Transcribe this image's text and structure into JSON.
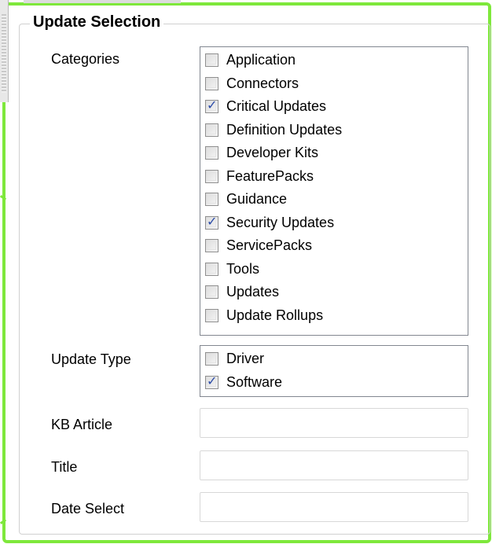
{
  "group": {
    "title": "Update Selection"
  },
  "categories": {
    "label": "Categories",
    "items": [
      {
        "label": "Application",
        "checked": false
      },
      {
        "label": "Connectors",
        "checked": false
      },
      {
        "label": "Critical Updates",
        "checked": true
      },
      {
        "label": "Definition Updates",
        "checked": false
      },
      {
        "label": "Developer Kits",
        "checked": false
      },
      {
        "label": "FeaturePacks",
        "checked": false
      },
      {
        "label": "Guidance",
        "checked": false
      },
      {
        "label": "Security Updates",
        "checked": true
      },
      {
        "label": "ServicePacks",
        "checked": false
      },
      {
        "label": "Tools",
        "checked": false
      },
      {
        "label": "Updates",
        "checked": false
      },
      {
        "label": "Update Rollups",
        "checked": false
      }
    ]
  },
  "update_type": {
    "label": "Update Type",
    "items": [
      {
        "label": "Driver",
        "checked": false
      },
      {
        "label": "Software",
        "checked": true
      }
    ]
  },
  "kb_article": {
    "label": "KB Article",
    "value": ""
  },
  "title_field": {
    "label": "Title",
    "value": ""
  },
  "date_select": {
    "label": "Date Select",
    "value": ""
  },
  "colors": {
    "frame_highlight": "#7ee83b",
    "checkmark": "#2a4aa8",
    "list_border": "#828790"
  }
}
